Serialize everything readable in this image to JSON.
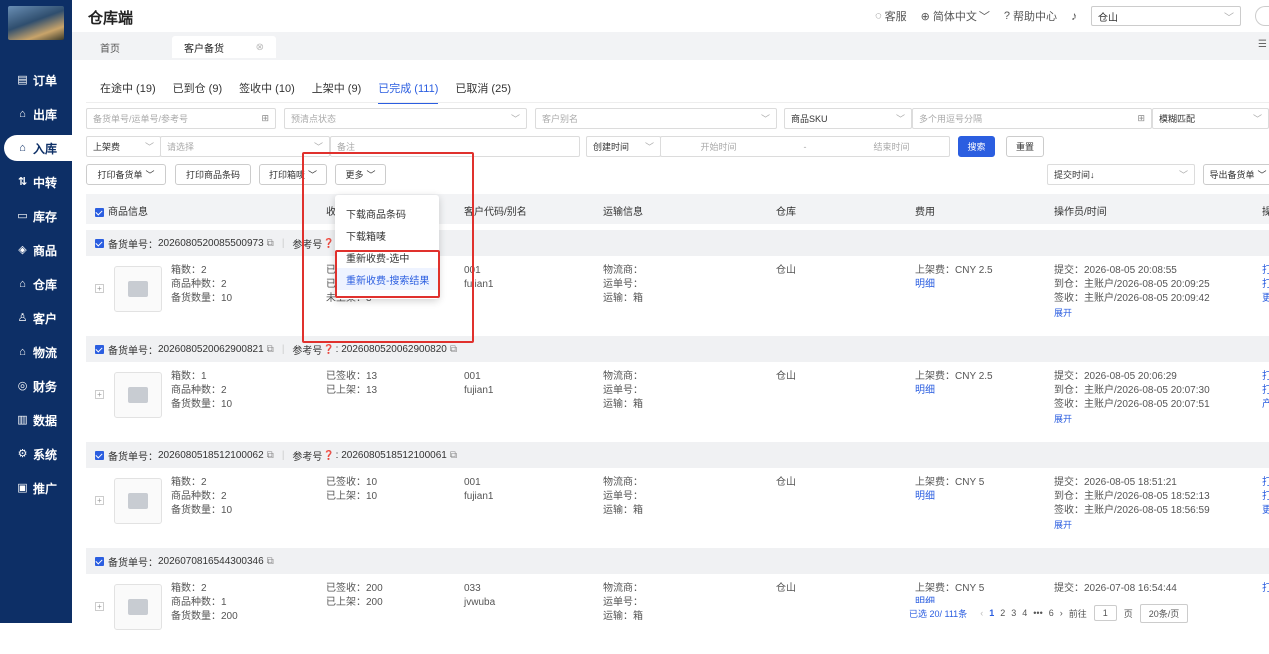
{
  "sidebar": {
    "items": [
      {
        "icon": "▤",
        "label": "订单",
        "icon_name": "order-icon"
      },
      {
        "icon": "⌂",
        "label": "出库",
        "icon_name": "outbound-icon"
      },
      {
        "icon": "⌂",
        "label": "入库",
        "icon_name": "inbound-icon"
      },
      {
        "icon": "⇅",
        "label": "中转",
        "icon_name": "transfer-icon"
      },
      {
        "icon": "▭",
        "label": "库存",
        "icon_name": "inventory-icon"
      },
      {
        "icon": "◈",
        "label": "商品",
        "icon_name": "product-icon"
      },
      {
        "icon": "⌂",
        "label": "仓库",
        "icon_name": "warehouse-icon"
      },
      {
        "icon": "♙",
        "label": "客户",
        "icon_name": "customer-icon"
      },
      {
        "icon": "⌂",
        "label": "物流",
        "icon_name": "logistics-icon"
      },
      {
        "icon": "◎",
        "label": "财务",
        "icon_name": "finance-icon"
      },
      {
        "icon": "▥",
        "label": "数据",
        "icon_name": "data-icon"
      },
      {
        "icon": "⚙",
        "label": "系统",
        "icon_name": "system-icon"
      },
      {
        "icon": "▣",
        "label": "推广",
        "icon_name": "promotion-icon"
      }
    ],
    "active": "入库"
  },
  "header": {
    "title": "仓库端",
    "service": "客服",
    "language": "简体中文",
    "help": "帮助中心",
    "warehouse": "仓山"
  },
  "page_tabs": {
    "home": "首页",
    "current": "客户备货"
  },
  "status_tabs": [
    "在途中 (19)",
    "已到仓 (9)",
    "签收中 (10)",
    "上架中 (9)",
    "已完成 (111)",
    "已取消 (25)"
  ],
  "filters": {
    "order_no_placeholder": "备货单号/运单号/参考号",
    "pre_status_placeholder": "预清点状态",
    "customer_alias_placeholder": "客户别名",
    "sku_type": "商品SKU",
    "multi_placeholder": "多个用逗号分隔",
    "match_mode": "模糊匹配",
    "fee_type": "上架费",
    "fee_select_placeholder": "请选择",
    "remark_placeholder": "备注",
    "time_type": "创建时间",
    "start_placeholder": "开始时间",
    "range_sep": "-",
    "end_placeholder": "结束时间",
    "search": "搜索",
    "reset": "重置"
  },
  "toolbar": {
    "print_order": "打印备货单",
    "print_barcode": "打印商品条码",
    "print_box": "打印箱唛",
    "more": "更多",
    "sort": "提交时间↓",
    "export": "导出备货单"
  },
  "more_menu": [
    "下载商品条码",
    "下载箱唛",
    "重新收费-选中",
    "重新收费-搜索结果"
  ],
  "table_headers": {
    "product": "商品信息",
    "receive": "收",
    "customer": "客户代码/别名",
    "shipping": "运输信息",
    "warehouse": "仓库",
    "fee": "费用",
    "operator": "操作员/时间",
    "action": "操"
  },
  "labels": {
    "order_no": "备货单号：",
    "ref_no": "参考号",
    "detail": "明细",
    "expand": "展开"
  },
  "groups": [
    {
      "order_no": "2026080520085500973",
      "ref_no": ": ",
      "box": "箱数：2",
      "kinds": "商品种数：2",
      "qty": "备货数量：10",
      "recv": [
        "已",
        "已",
        "未上架：3"
      ],
      "customer": "001",
      "alias": "fujian1",
      "ship": [
        "物流商：",
        "运单号：",
        "运输：箱"
      ],
      "warehouse": "仓山",
      "fee": "上架费：CNY 2.5",
      "ops": [
        "提交：2026-08-05 20:08:55",
        "到仓：主账户/2026-08-05 20:09:25",
        "签收：主账户/2026-08-05 20:09:42"
      ],
      "act": [
        "打",
        "打",
        "更"
      ]
    },
    {
      "order_no": "2026080520062900821",
      "ref_no": ": 2026080520062900820",
      "box": "箱数：1",
      "kinds": "商品种数：2",
      "qty": "备货数量：10",
      "recv": [
        "已签收：13",
        "已上架：13"
      ],
      "customer": "001",
      "alias": "fujian1",
      "ship": [
        "物流商：",
        "运单号：",
        "运输：箱"
      ],
      "warehouse": "仓山",
      "fee": "上架费：CNY 2.5",
      "ops": [
        "提交：2026-08-05 20:06:29",
        "到仓：主账户/2026-08-05 20:07:30",
        "签收：主账户/2026-08-05 20:07:51"
      ],
      "act": [
        "打",
        "打",
        "产"
      ]
    },
    {
      "order_no": "2026080518512100062",
      "ref_no": ": 2026080518512100061",
      "box": "箱数：2",
      "kinds": "商品种数：2",
      "qty": "备货数量：10",
      "recv": [
        "已签收：10",
        "已上架：10"
      ],
      "customer": "001",
      "alias": "fujian1",
      "ship": [
        "物流商：",
        "运单号：",
        "运输：箱"
      ],
      "warehouse": "仓山",
      "fee": "上架费：CNY 5",
      "ops": [
        "提交：2026-08-05 18:51:21",
        "到仓：主账户/2026-08-05 18:52:13",
        "签收：主账户/2026-08-05 18:56:59"
      ],
      "act": [
        "打",
        "打",
        "更"
      ]
    },
    {
      "order_no": "2026070816544300346",
      "box": "箱数：2",
      "kinds": "商品种数：1",
      "qty": "备货数量：200",
      "recv": [
        "已签收：200",
        "已上架：200"
      ],
      "customer": "033",
      "alias": "jvwuba",
      "ship": [
        "物流商：",
        "运单号：",
        "运输：箱"
      ],
      "warehouse": "仓山",
      "fee": "上架费：CNY 5",
      "ops": [
        "提交：2026-07-08 16:54:44"
      ],
      "act": [
        "打"
      ]
    }
  ],
  "pagination": {
    "summary": "已选 20/ 111条",
    "pages": [
      "1",
      "2",
      "3",
      "4",
      "•••",
      "6"
    ],
    "goto": "前往",
    "page_input": "1",
    "page_unit": "页",
    "page_size": "20条/页"
  }
}
